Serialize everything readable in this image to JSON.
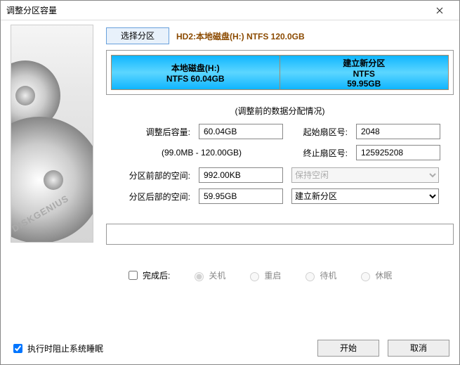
{
  "window": {
    "title": "调整分区容量"
  },
  "brand": "DISKGENIUS",
  "top": {
    "select_partition": "选择分区",
    "disk_info": "HD2:本地磁盘(H:) NTFS 120.0GB"
  },
  "partitions": [
    {
      "line1": "本地磁盘(H:)",
      "line2": "NTFS 60.04GB"
    },
    {
      "line1": "建立新分区",
      "line2": "NTFS",
      "line3": "59.95GB"
    }
  ],
  "caption": "(调整前的数据分配情况)",
  "labels": {
    "after_size": "调整后容量:",
    "range": "(99.0MB - 120.00GB)",
    "start_sector": "起始扇区号:",
    "end_sector": "终止扇区号:",
    "space_before": "分区前部的空间:",
    "space_after": "分区后部的空间:"
  },
  "values": {
    "after_size": "60.04GB",
    "start_sector": "2048",
    "end_sector": "125925208",
    "space_before": "992.00KB",
    "space_after": "59.95GB"
  },
  "selects": {
    "before_action": "保持空闲",
    "after_action": "建立新分区"
  },
  "after": {
    "label": "完成后:",
    "shutdown": "关机",
    "restart": "重启",
    "standby": "待机",
    "hibernate": "休眠"
  },
  "bottom": {
    "prevent_sleep": "执行时阻止系统睡眠",
    "start": "开始",
    "cancel": "取消"
  }
}
